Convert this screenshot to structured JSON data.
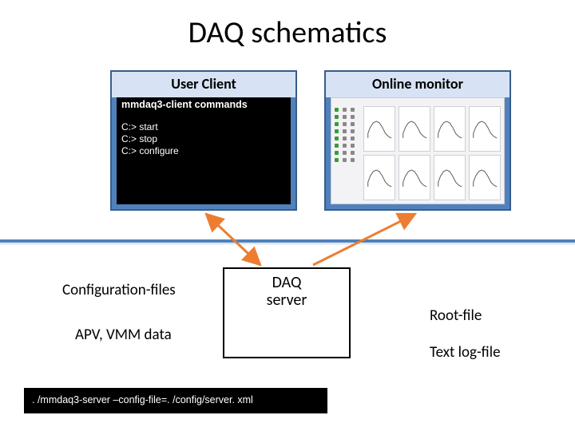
{
  "title": "DAQ schematics",
  "user_client": {
    "header": "User Client",
    "terminal_title": "mmdaq3-client commands",
    "lines": [
      "C:> start",
      "C:> stop",
      "C:> configure"
    ]
  },
  "online_monitor": {
    "header": "Online monitor"
  },
  "daq_server": {
    "line1": "DAQ",
    "line2": "server"
  },
  "labels": {
    "config_files": "Configuration-files",
    "apv_vmm": "APV, VMM data",
    "root_file": "Root-file",
    "text_log": "Text log-file"
  },
  "command_bar": ". /mmdaq3-server –config-file=. /config/server. xml"
}
